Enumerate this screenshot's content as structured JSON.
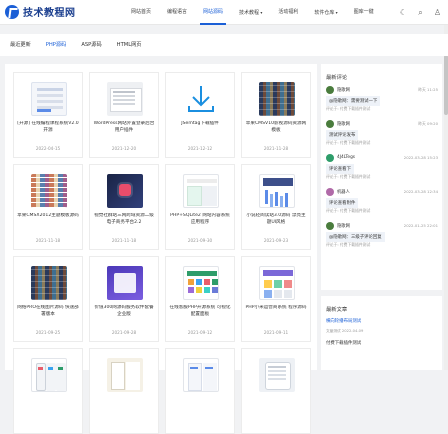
{
  "header": {
    "logo_text": "技术教程网",
    "nav": [
      "网站首页",
      "编程语言",
      "网站源码",
      "技术教程",
      "活动福利",
      "软件仓库",
      "图库一键"
    ],
    "active_nav": "网站源码"
  },
  "categories": {
    "items": [
      "最近更新",
      "PHP源码",
      "ASP源码",
      "HTML网页"
    ],
    "active": "PHP源码"
  },
  "cards": [
    {
      "title": "[开源] 在线编程课程系统V2.0开源",
      "date": "2022-04-15",
      "thumb": "doc"
    },
    {
      "title": "WordPress网站外置登录后台用户插件",
      "date": "2021-12-20",
      "thumb": "ui"
    },
    {
      "title": "JSemtag下载插件",
      "date": "2021-12-12",
      "thumb": "download"
    },
    {
      "title": "苹果CMSV10影视源码资源网模板",
      "date": "2021-11-28",
      "thumb": "mosaic"
    },
    {
      "title": "苹果CMSX2012主题模板源码",
      "date": "2021-11-18",
      "thumb": "thumbs"
    },
    {
      "title": "视觉社群站三网跨域资源二级电子商务平台2.2",
      "date": "2021-11-18",
      "thumb": "dark"
    },
    {
      "title": "PHP+SQLite2 网站内容系统应用程序",
      "date": "2021-09-30",
      "thumb": "mint"
    },
    {
      "title": "小说轻阅读站3.0源码 漂亮主题UI风格",
      "date": "2021-09-23",
      "thumb": "chart"
    },
    {
      "title": "网络PRO在线图片源码 快速部署版本",
      "date": "2021-09-25",
      "thumb": "mosaic"
    },
    {
      "title": "价值300网源码服务软件套餐企业版",
      "date": "2021-09-28",
      "thumb": "purple"
    },
    {
      "title": "在线客服PHP开源系统 可视化配置面板",
      "date": "2021-09-12",
      "thumb": "colors"
    },
    {
      "title": "PHP小米运营商系统 程序源码",
      "date": "2021-09-11",
      "thumb": "white"
    },
    {
      "title": "",
      "date": "",
      "thumb": "phones"
    },
    {
      "title": "",
      "date": "",
      "thumb": "apps"
    },
    {
      "title": "",
      "date": "",
      "thumb": "docs2"
    },
    {
      "title": "",
      "date": "",
      "thumb": "tablet"
    }
  ],
  "sidebar": {
    "comments_title": "最新评论",
    "comments": [
      {
        "user": "隐歌网",
        "time": "昨天 11:25",
        "text": "@隐歌网：需要测试一下",
        "ref": "评论于: 付费下载插件测试",
        "avatar_color": "#4a7c3d"
      },
      {
        "user": "隐歌网",
        "time": "昨天 09:20",
        "text": "测试评论发布",
        "ref": "评论于: 付费下载插件测试",
        "avatar_color": "#4a7c3d"
      },
      {
        "user": "4J4LTegs",
        "time": "2022-03-28 15:23",
        "text": "评论查看下",
        "ref": "评论于: 付费下载插件测试",
        "avatar_color": "#2e9d6a"
      },
      {
        "user": "机器人",
        "time": "2022-03-28 12:34",
        "text": "评论查看附件",
        "ref": "评论于: 付费下载插件测试",
        "avatar_color": "#b06aa8"
      },
      {
        "user": "隐歌网",
        "time": "2022-01-25 22:01",
        "text": "@隐歌网：三级子评论回复",
        "ref": "评论于: 付费下载插件测试",
        "avatar_color": "#4a7c3d"
      }
    ],
    "articles_title": "最新文章",
    "articles": [
      {
        "title": "横向轮播布局测试",
        "meta": "文章测试   2022-04-09"
      },
      {
        "title": "付费下载插件测试",
        "meta": ""
      }
    ]
  }
}
